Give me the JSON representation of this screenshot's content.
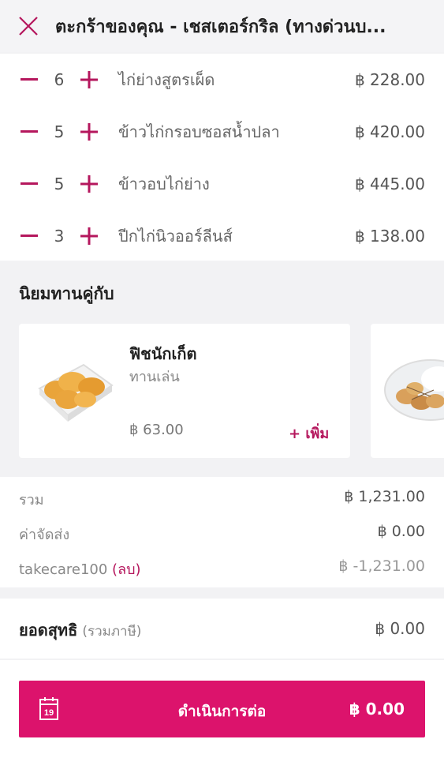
{
  "header": {
    "title": "ตะกร้าของคุณ - เชสเตอร์กริล (ทางด่วนบ..."
  },
  "cart": {
    "items": [
      {
        "qty": "6",
        "name": "ไก่ย่างสูตรเผ็ด",
        "price": "฿ 228.00"
      },
      {
        "qty": "5",
        "name": "ข้าวไก่กรอบซอสน้ำปลา",
        "price": "฿ 420.00"
      },
      {
        "qty": "5",
        "name": "ข้าวอบไก่ย่าง",
        "price": "฿ 445.00"
      },
      {
        "qty": "3",
        "name": "ปีกไก่นิวออร์ลีนส์",
        "price": "฿ 138.00"
      }
    ]
  },
  "recommend": {
    "heading": "นิยมทานคู่กับ",
    "card": {
      "name": "ฟิชนักเก็ต",
      "category": "ทานเล่น",
      "price": "฿ 63.00",
      "add_label": "+ เพิ่ม"
    }
  },
  "summary": {
    "subtotal_label": "รวม",
    "subtotal_value": "฿ 1,231.00",
    "delivery_label": "ค่าจัดส่ง",
    "delivery_value": "฿ 0.00",
    "promo_code": "takecare100",
    "promo_remove": "(ลบ)",
    "promo_value": "฿ -1,231.00"
  },
  "total": {
    "label": "ยอดสุทธิ",
    "note": "(รวมภาษี)",
    "value": "฿ 0.00"
  },
  "checkout": {
    "label": "ดำเนินการต่อ",
    "total": "฿ 0.00",
    "calendar_day": "19"
  },
  "colors": {
    "accent": "#dc136c",
    "accent_text": "#b5175d"
  },
  "icons": {
    "close": "close-icon",
    "minus": "minus-icon",
    "plus": "plus-icon",
    "calendar": "calendar-icon"
  }
}
